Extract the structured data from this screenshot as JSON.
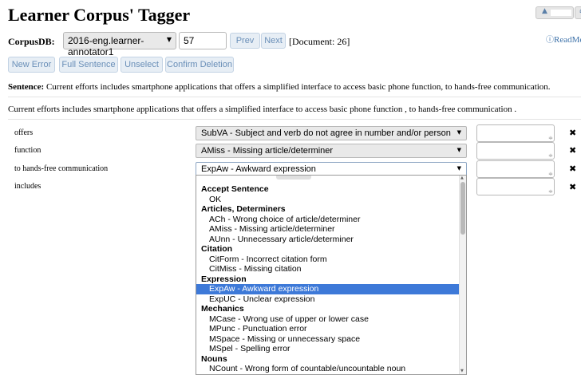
{
  "title": "Learner Corpus' Tagger",
  "user": {
    "icon": "user-icon",
    "home_icon": "home-icon"
  },
  "corpusdb": {
    "label": "CorpusDB:",
    "selected": "2016-eng.learner-annotator1",
    "doc_input": "57",
    "doc_label": "[Document: 26]"
  },
  "nav": {
    "prev": "Prev",
    "next": "Next",
    "readme": "ReadMe",
    "readme_icon": "info-icon"
  },
  "actions": {
    "new_error": "New Error",
    "full_sentence": "Full Sentence",
    "unselect": "Unselect",
    "confirm_deletion": "Confirm Deletion"
  },
  "sentence": {
    "label": "Sentence:",
    "text": "Current efforts includes smartphone applications that offers a simplified interface to access basic phone function, to hands-free communication.",
    "tokenized": "Current efforts includes smartphone applications that offers a simplified interface to access basic phone function , to hands-free communication ."
  },
  "errors": [
    {
      "token": "offers",
      "tag": "SubVA - Subject and verb do not agree in number and/or person",
      "note": ""
    },
    {
      "token": "function",
      "tag": "AMiss - Missing article/determiner",
      "note": ""
    },
    {
      "token": "to hands-free communication",
      "tag": "ExpAw - Awkward expression",
      "note": ""
    },
    {
      "token": "includes",
      "tag": "",
      "note": ""
    }
  ],
  "delete_icon": "close-icon",
  "dropdown": [
    {
      "kind": "group",
      "label": "Accept Sentence"
    },
    {
      "kind": "opt",
      "label": "OK"
    },
    {
      "kind": "group",
      "label": "Articles, Determiners"
    },
    {
      "kind": "opt",
      "label": "ACh - Wrong choice of article/determiner"
    },
    {
      "kind": "opt",
      "label": "AMiss - Missing article/determiner"
    },
    {
      "kind": "opt",
      "label": "AUnn - Unnecessary article/determiner"
    },
    {
      "kind": "group",
      "label": "Citation"
    },
    {
      "kind": "opt",
      "label": "CitForm - Incorrect citation form"
    },
    {
      "kind": "opt",
      "label": "CitMiss - Missing citation"
    },
    {
      "kind": "group",
      "label": "Expression"
    },
    {
      "kind": "opt",
      "label": "ExpAw - Awkward expression",
      "selected": true
    },
    {
      "kind": "opt",
      "label": "ExpUC - Unclear expression"
    },
    {
      "kind": "group",
      "label": "Mechanics"
    },
    {
      "kind": "opt",
      "label": "MCase - Wrong use of upper or lower case"
    },
    {
      "kind": "opt",
      "label": "MPunc - Punctuation error"
    },
    {
      "kind": "opt",
      "label": "MSpace - Missing or unnecessary space"
    },
    {
      "kind": "opt",
      "label": "MSpel - Spelling error"
    },
    {
      "kind": "group",
      "label": "Nouns"
    },
    {
      "kind": "opt",
      "label": "NCount - Wrong form of countable/uncountable noun"
    }
  ],
  "colors": {
    "button_text": "#6a8fb8",
    "button_bg": "#e7eef5",
    "selected_option": "#3d79d8",
    "link": "#3b70a8"
  }
}
